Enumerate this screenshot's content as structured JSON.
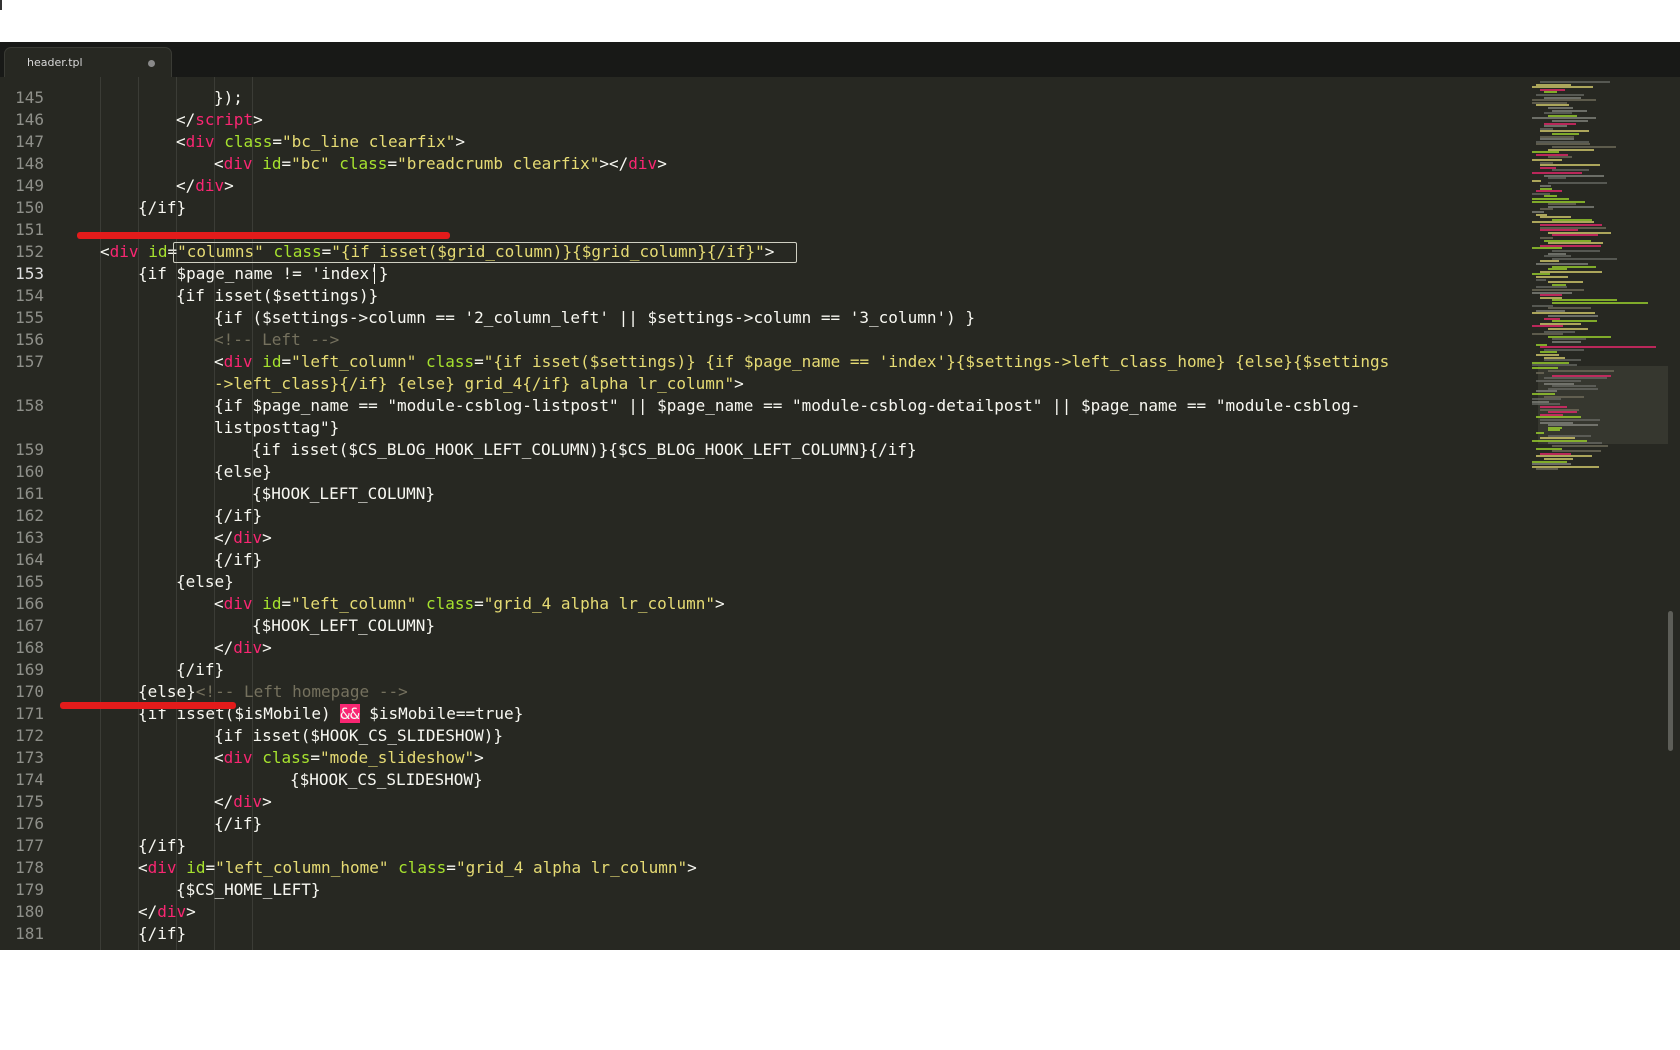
{
  "tab": {
    "title": "header.tpl"
  },
  "colors": {
    "background": "#272822",
    "tag": "#f92672",
    "attribute": "#a6e22e",
    "string": "#e6db74",
    "comment": "#75715e",
    "plain": "#f8f8f2",
    "annotation": "#e31b1b"
  },
  "editor": {
    "active_line": 153,
    "lines": [
      {
        "n": "145",
        "indent": 3,
        "tokens": [
          [
            "p",
            "});"
          ]
        ]
      },
      {
        "n": "146",
        "indent": 2,
        "tokens": [
          [
            "p",
            "</"
          ],
          [
            "t",
            "script"
          ],
          [
            "p",
            ">"
          ]
        ]
      },
      {
        "n": "147",
        "indent": 2,
        "tokens": [
          [
            "p",
            "<"
          ],
          [
            "t",
            "div"
          ],
          [
            "p",
            " "
          ],
          [
            "a",
            "class"
          ],
          [
            "p",
            "="
          ],
          [
            "s",
            "\"bc_line clearfix\""
          ],
          [
            "p",
            ">"
          ]
        ]
      },
      {
        "n": "148",
        "indent": 3,
        "tokens": [
          [
            "p",
            "<"
          ],
          [
            "t",
            "div"
          ],
          [
            "p",
            " "
          ],
          [
            "a",
            "id"
          ],
          [
            "p",
            "="
          ],
          [
            "s",
            "\"bc\""
          ],
          [
            "p",
            " "
          ],
          [
            "a",
            "class"
          ],
          [
            "p",
            "="
          ],
          [
            "s",
            "\"breadcrumb clearfix\""
          ],
          [
            "p",
            "></"
          ],
          [
            "t",
            "div"
          ],
          [
            "p",
            ">"
          ]
        ]
      },
      {
        "n": "149",
        "indent": 2,
        "tokens": [
          [
            "p",
            "</"
          ],
          [
            "t",
            "div"
          ],
          [
            "p",
            ">"
          ]
        ]
      },
      {
        "n": "150",
        "indent": 1,
        "tokens": [
          [
            "p",
            "{/if}"
          ]
        ]
      },
      {
        "n": "151",
        "indent": 0,
        "tokens": []
      },
      {
        "n": "152",
        "indent": 0,
        "tokens": [
          [
            "p",
            "<"
          ],
          [
            "t",
            "div"
          ],
          [
            "p",
            " "
          ],
          [
            "a",
            "id"
          ],
          [
            "p",
            "="
          ],
          [
            "s",
            "\"columns\""
          ],
          [
            "p",
            " "
          ],
          [
            "a",
            "class"
          ],
          [
            "p",
            "="
          ],
          [
            "s",
            "\"{if isset($grid_column)}{$grid_column}{/if}\""
          ],
          [
            "p",
            ">"
          ]
        ]
      },
      {
        "n": "153",
        "indent": 1,
        "tokens": [
          [
            "p",
            "{if $page_name != 'index'}"
          ]
        ]
      },
      {
        "n": "154",
        "indent": 2,
        "tokens": [
          [
            "p",
            "{if isset($settings)}"
          ]
        ]
      },
      {
        "n": "155",
        "indent": 3,
        "tokens": [
          [
            "p",
            "{if ($settings->column == '2_column_left' || $settings->column == '3_column') }"
          ]
        ]
      },
      {
        "n": "156",
        "indent": 3,
        "tokens": [
          [
            "c",
            "<!-- Left -->"
          ]
        ]
      },
      {
        "n": "157",
        "indent": 3,
        "tokens": [
          [
            "p",
            "<"
          ],
          [
            "t",
            "div"
          ],
          [
            "p",
            " "
          ],
          [
            "a",
            "id"
          ],
          [
            "p",
            "="
          ],
          [
            "s",
            "\"left_column\""
          ],
          [
            "p",
            " "
          ],
          [
            "a",
            "class"
          ],
          [
            "p",
            "="
          ],
          [
            "s",
            "\"{if isset($settings)} {if $page_name == 'index'}{$settings->left_class_home} {else}{$settings"
          ]
        ]
      },
      {
        "n": "",
        "indent": 3,
        "tokens": [
          [
            "s",
            "->left_class}{/if} {else} grid_4{/if} alpha lr_column\""
          ],
          [
            "p",
            ">"
          ]
        ]
      },
      {
        "n": "158",
        "indent": 3,
        "tokens": [
          [
            "p",
            "{if $page_name == \"module-csblog-listpost\" || $page_name == \"module-csblog-detailpost\" || $page_name == \"module-csblog-"
          ]
        ]
      },
      {
        "n": "",
        "indent": 3,
        "tokens": [
          [
            "p",
            "listposttag\"}"
          ]
        ]
      },
      {
        "n": "159",
        "indent": 4,
        "tokens": [
          [
            "p",
            "{if isset($CS_BLOG_HOOK_LEFT_COLUMN)}{$CS_BLOG_HOOK_LEFT_COLUMN}{/if}"
          ]
        ]
      },
      {
        "n": "160",
        "indent": 3,
        "tokens": [
          [
            "p",
            "{else}"
          ]
        ]
      },
      {
        "n": "161",
        "indent": 4,
        "tokens": [
          [
            "p",
            "{$HOOK_LEFT_COLUMN}"
          ]
        ]
      },
      {
        "n": "162",
        "indent": 3,
        "tokens": [
          [
            "p",
            "{/if}"
          ]
        ]
      },
      {
        "n": "163",
        "indent": 3,
        "tokens": [
          [
            "p",
            "</"
          ],
          [
            "t",
            "div"
          ],
          [
            "p",
            ">"
          ]
        ]
      },
      {
        "n": "164",
        "indent": 3,
        "tokens": [
          [
            "p",
            "{/if}"
          ]
        ]
      },
      {
        "n": "165",
        "indent": 2,
        "tokens": [
          [
            "p",
            "{else}"
          ]
        ]
      },
      {
        "n": "166",
        "indent": 3,
        "tokens": [
          [
            "p",
            "<"
          ],
          [
            "t",
            "div"
          ],
          [
            "p",
            " "
          ],
          [
            "a",
            "id"
          ],
          [
            "p",
            "="
          ],
          [
            "s",
            "\"left_column\""
          ],
          [
            "p",
            " "
          ],
          [
            "a",
            "class"
          ],
          [
            "p",
            "="
          ],
          [
            "s",
            "\"grid_4 alpha lr_column\""
          ],
          [
            "p",
            ">"
          ]
        ]
      },
      {
        "n": "167",
        "indent": 4,
        "tokens": [
          [
            "p",
            "{$HOOK_LEFT_COLUMN}"
          ]
        ]
      },
      {
        "n": "168",
        "indent": 3,
        "tokens": [
          [
            "p",
            "</"
          ],
          [
            "t",
            "div"
          ],
          [
            "p",
            ">"
          ]
        ]
      },
      {
        "n": "169",
        "indent": 2,
        "tokens": [
          [
            "p",
            "{/if}"
          ]
        ]
      },
      {
        "n": "170",
        "indent": 1,
        "tokens": [
          [
            "p",
            "{else}"
          ],
          [
            "c",
            "<!-- Left homepage -->"
          ]
        ]
      },
      {
        "n": "171",
        "indent": 1,
        "tokens": [
          [
            "p",
            "{if isset($isMobile) "
          ],
          [
            "h",
            "&&"
          ],
          [
            "p",
            " $isMobile==true}"
          ]
        ]
      },
      {
        "n": "172",
        "indent": 3,
        "tokens": [
          [
            "p",
            "{if isset($HOOK_CS_SLIDESHOW)}"
          ]
        ]
      },
      {
        "n": "173",
        "indent": 3,
        "tokens": [
          [
            "p",
            "<"
          ],
          [
            "t",
            "div"
          ],
          [
            "p",
            " "
          ],
          [
            "a",
            "class"
          ],
          [
            "p",
            "="
          ],
          [
            "s",
            "\"mode_slideshow\""
          ],
          [
            "p",
            ">"
          ]
        ]
      },
      {
        "n": "174",
        "indent": 5,
        "tokens": [
          [
            "p",
            "{$HOOK_CS_SLIDESHOW}"
          ]
        ]
      },
      {
        "n": "175",
        "indent": 3,
        "tokens": [
          [
            "p",
            "</"
          ],
          [
            "t",
            "div"
          ],
          [
            "p",
            ">"
          ]
        ]
      },
      {
        "n": "176",
        "indent": 3,
        "tokens": [
          [
            "p",
            "{/if}"
          ]
        ]
      },
      {
        "n": "177",
        "indent": 1,
        "tokens": [
          [
            "p",
            "{/if}"
          ]
        ]
      },
      {
        "n": "178",
        "indent": 1,
        "tokens": [
          [
            "p",
            "<"
          ],
          [
            "t",
            "div"
          ],
          [
            "p",
            " "
          ],
          [
            "a",
            "id"
          ],
          [
            "p",
            "="
          ],
          [
            "s",
            "\"left_column_home\""
          ],
          [
            "p",
            " "
          ],
          [
            "a",
            "class"
          ],
          [
            "p",
            "="
          ],
          [
            "s",
            "\"grid_4 alpha lr_column\""
          ],
          [
            "p",
            ">"
          ]
        ]
      },
      {
        "n": "179",
        "indent": 2,
        "tokens": [
          [
            "p",
            "{$CS_HOME_LEFT}"
          ]
        ]
      },
      {
        "n": "180",
        "indent": 1,
        "tokens": [
          [
            "p",
            "</"
          ],
          [
            "t",
            "div"
          ],
          [
            "p",
            ">"
          ]
        ]
      },
      {
        "n": "181",
        "indent": 1,
        "tokens": [
          [
            "p",
            "{/if}"
          ]
        ]
      }
    ]
  }
}
